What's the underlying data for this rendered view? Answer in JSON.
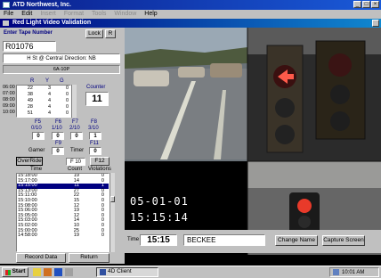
{
  "window": {
    "title": "ATD Northwest, Inc."
  },
  "menu": {
    "file": "File",
    "edit": "Edit",
    "items_dim": [
      "Insert",
      "Format",
      "Tools",
      "Window"
    ],
    "help": "Help"
  },
  "subwindow": {
    "title": "Red Light Video Validation"
  },
  "tape": {
    "label": "Enter Tape Number",
    "lock_button": "Lock",
    "r_button": "R",
    "value": "R01076"
  },
  "location": {
    "primary": "H St @ Central  Direction: NB",
    "secondary": "6A-10P"
  },
  "ryg": {
    "headers": [
      "R",
      "Y",
      "G"
    ],
    "times": [
      "06:00",
      "07:00",
      "08:00",
      "09:00",
      "10:00"
    ],
    "rows": [
      [
        "22",
        "3",
        "0"
      ],
      [
        "38",
        "4",
        "0"
      ],
      [
        "49",
        "4",
        "0"
      ],
      [
        "28",
        "4",
        "0"
      ],
      [
        "51",
        "4",
        "0"
      ]
    ]
  },
  "counter": {
    "label": "Counter",
    "value": "11"
  },
  "function_keys": {
    "row1": [
      {
        "key": "F5",
        "sub": "0/10",
        "value": "0"
      },
      {
        "key": "F6",
        "sub": "1/10",
        "value": "0"
      },
      {
        "key": "F7",
        "sub": "2/10",
        "value": "0"
      },
      {
        "key": "F8",
        "sub": "3/10",
        "value": "1"
      }
    ],
    "f9_label": "F9",
    "f11_label": "F11",
    "gamer_label": "Gamer",
    "gamer_value": "0",
    "timer_label": "Timer",
    "timer_value": "0"
  },
  "controls": {
    "override_button": "OverRide",
    "f10_value": "F 10",
    "f12_button": "F12"
  },
  "list": {
    "headers": [
      "Time",
      "Count",
      "Violations"
    ],
    "rows": [
      {
        "time": "15:18:00",
        "count": "19",
        "violations": "0"
      },
      {
        "time": "15:17:00",
        "count": "14",
        "violations": "0"
      },
      {
        "time": "15:15:00",
        "count": "11",
        "violations": "1"
      },
      {
        "time": "15:13:00",
        "count": "27",
        "violations": "0"
      },
      {
        "time": "15:11:00",
        "count": "22",
        "violations": "0"
      },
      {
        "time": "15:10:00",
        "count": "15",
        "violations": "0"
      },
      {
        "time": "15:08:00",
        "count": "12",
        "violations": "0"
      },
      {
        "time": "15:06:00",
        "count": "19",
        "violations": "0"
      },
      {
        "time": "15:05:00",
        "count": "12",
        "violations": "0"
      },
      {
        "time": "15:03:00",
        "count": "14",
        "violations": "0"
      },
      {
        "time": "15:02:00",
        "count": "10",
        "violations": "0"
      },
      {
        "time": "15:00:00",
        "count": "25",
        "violations": "0"
      },
      {
        "time": "14:58:00",
        "count": "19",
        "violations": "0"
      }
    ],
    "selected_index": 2
  },
  "actions": {
    "record_data": "Record Data",
    "return": "Return"
  },
  "video": {
    "date": "05-01-01",
    "time": "15:15:14"
  },
  "bottom": {
    "time_label": "Time",
    "time_value": "15:15",
    "name_value": "BECKEE",
    "change_name": "Change Name",
    "capture_screen": "Capture Screen"
  },
  "taskbar": {
    "start": "Start",
    "task": "4D Client",
    "clock": "10:01 AM"
  },
  "colors": {
    "title_bar": "#0a1e8c",
    "selection": "#000080",
    "panel": "#c0c0c0"
  }
}
